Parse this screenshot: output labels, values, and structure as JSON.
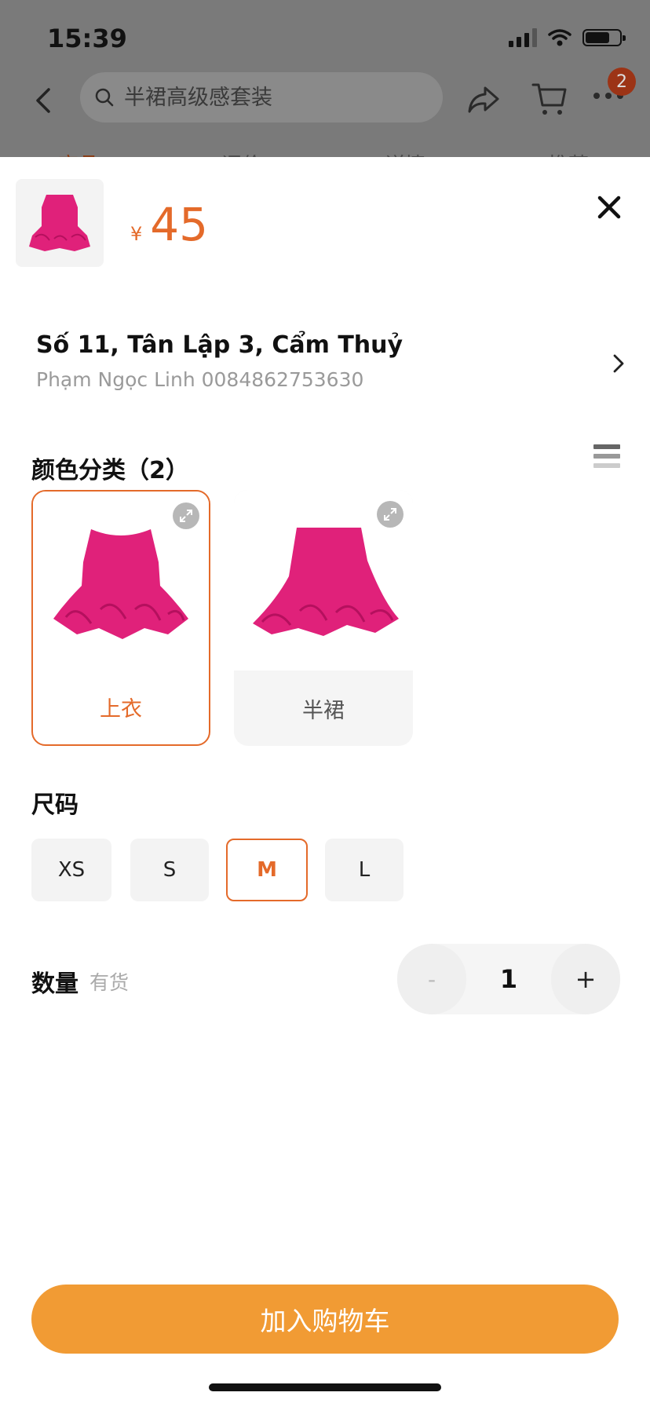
{
  "status": {
    "time": "15:39"
  },
  "topnav": {
    "search_placeholder": "半裙高级感套装",
    "more_badge": "2",
    "tabs": [
      "商品",
      "评价",
      "详情",
      "推荐"
    ]
  },
  "sheet": {
    "price_currency": "¥",
    "price_value": "45",
    "address": {
      "line": "Số 11, Tân Lập 3, Cẩm Thuỷ",
      "person": "Phạm Ngọc Linh 0084862753630"
    },
    "color_section_title": "颜色分类（2）",
    "color_options": [
      {
        "label": "上衣",
        "selected": true
      },
      {
        "label": "半裙",
        "selected": false
      }
    ],
    "size_section_title": "尺码",
    "sizes": [
      "XS",
      "S",
      "M",
      "L"
    ],
    "selected_size": "M",
    "quantity_label": "数量",
    "stock_status": "有货",
    "quantity_minus": "-",
    "quantity_value": "1",
    "quantity_plus": "+",
    "add_to_cart": "加入购物车"
  },
  "colors": {
    "accent": "#e46a2a",
    "button": "#f19b34",
    "product": "#e0217a"
  }
}
